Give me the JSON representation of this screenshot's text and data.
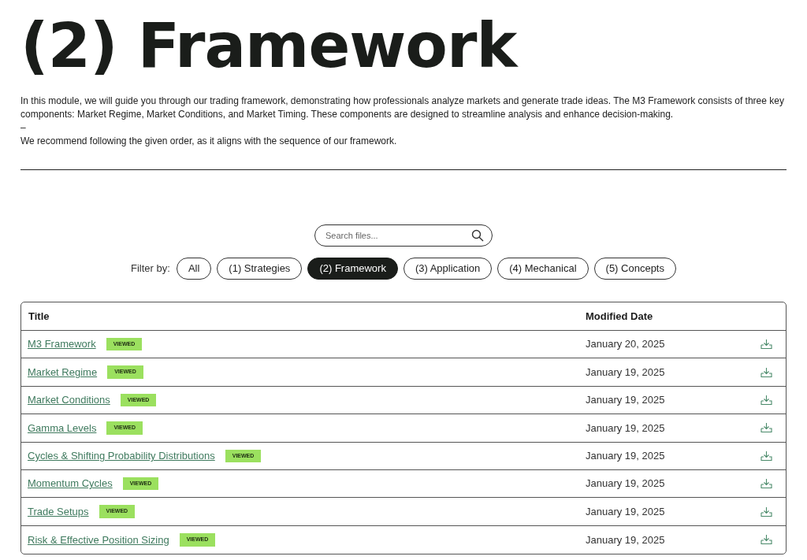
{
  "heading": "(2) Framework",
  "description": [
    "In this module, we will guide you through our trading framework, demonstrating how professionals analyze markets and generate trade ideas. The M3 Framework consists of three key components: Market Regime, Market Conditions, and Market Timing. These components are designed to streamline analysis and enhance decision-making.",
    "–",
    "We recommend following the given order, as it aligns with the sequence of our framework."
  ],
  "search": {
    "placeholder": "Search files..."
  },
  "filter": {
    "label": "Filter by:",
    "options": [
      {
        "label": "All",
        "selected": false
      },
      {
        "label": "(1) Strategies",
        "selected": false
      },
      {
        "label": "(2) Framework",
        "selected": true
      },
      {
        "label": "(3) Application",
        "selected": false
      },
      {
        "label": "(4) Mechanical",
        "selected": false
      },
      {
        "label": "(5) Concepts",
        "selected": false
      }
    ]
  },
  "table": {
    "columns": [
      "Title",
      "Modified Date"
    ],
    "rows": [
      {
        "title": "M3 Framework",
        "viewed": true,
        "badge": "VIEWED",
        "date": "January 20, 2025"
      },
      {
        "title": "Market Regime",
        "viewed": true,
        "badge": "VIEWED",
        "date": "January 19, 2025"
      },
      {
        "title": "Market Conditions",
        "viewed": true,
        "badge": "VIEWED",
        "date": "January 19, 2025"
      },
      {
        "title": "Gamma Levels",
        "viewed": true,
        "badge": "VIEWED",
        "date": "January 19, 2025"
      },
      {
        "title": "Cycles & Shifting Probability Distributions",
        "viewed": true,
        "badge": "VIEWED",
        "date": "January 19, 2025"
      },
      {
        "title": "Momentum Cycles",
        "viewed": true,
        "badge": "VIEWED",
        "date": "January 19, 2025"
      },
      {
        "title": "Trade Setups",
        "viewed": true,
        "badge": "VIEWED",
        "date": "January 19, 2025"
      },
      {
        "title": "Risk & Effective Position Sizing",
        "viewed": true,
        "badge": "VIEWED",
        "date": "January 19, 2025"
      }
    ]
  }
}
